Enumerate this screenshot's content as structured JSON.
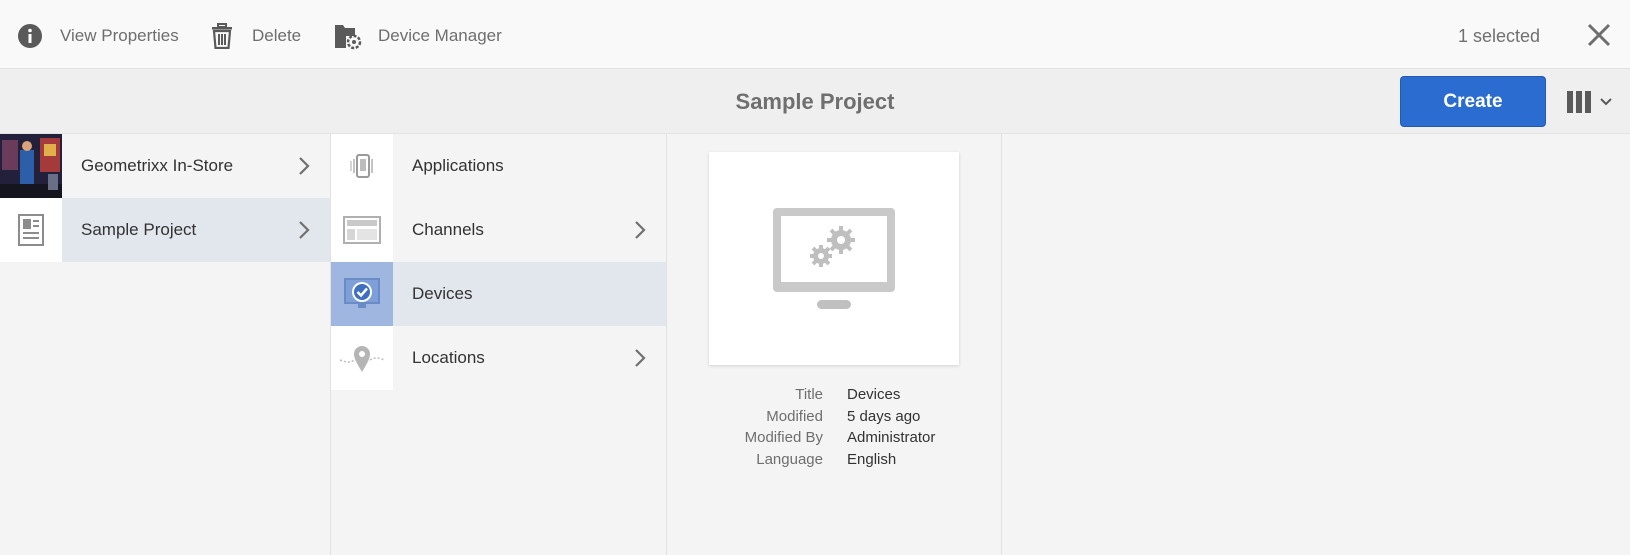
{
  "actionbar": {
    "actions": [
      {
        "label": "View Properties",
        "icon": "info-icon"
      },
      {
        "label": "Delete",
        "icon": "trash-icon"
      },
      {
        "label": "Device Manager",
        "icon": "device-manager-icon"
      }
    ],
    "selected_count": "1 selected"
  },
  "titlebar": {
    "title": "Sample Project",
    "create_label": "Create"
  },
  "column1": {
    "items": [
      {
        "label": "Geometrixx In-Store"
      },
      {
        "label": "Sample Project"
      }
    ]
  },
  "column2": {
    "items": [
      {
        "label": "Applications"
      },
      {
        "label": "Channels"
      },
      {
        "label": "Devices"
      },
      {
        "label": "Locations"
      }
    ]
  },
  "details": {
    "fields": [
      {
        "key": "Title",
        "value": "Devices"
      },
      {
        "key": "Modified",
        "value": "5 days ago"
      },
      {
        "key": "Modified By",
        "value": "Administrator"
      },
      {
        "key": "Language",
        "value": "English"
      }
    ]
  },
  "colors": {
    "accent": "#2b6cd0",
    "active_row": "#e2e7ee",
    "selected_thumb": "#9fb7e0"
  }
}
